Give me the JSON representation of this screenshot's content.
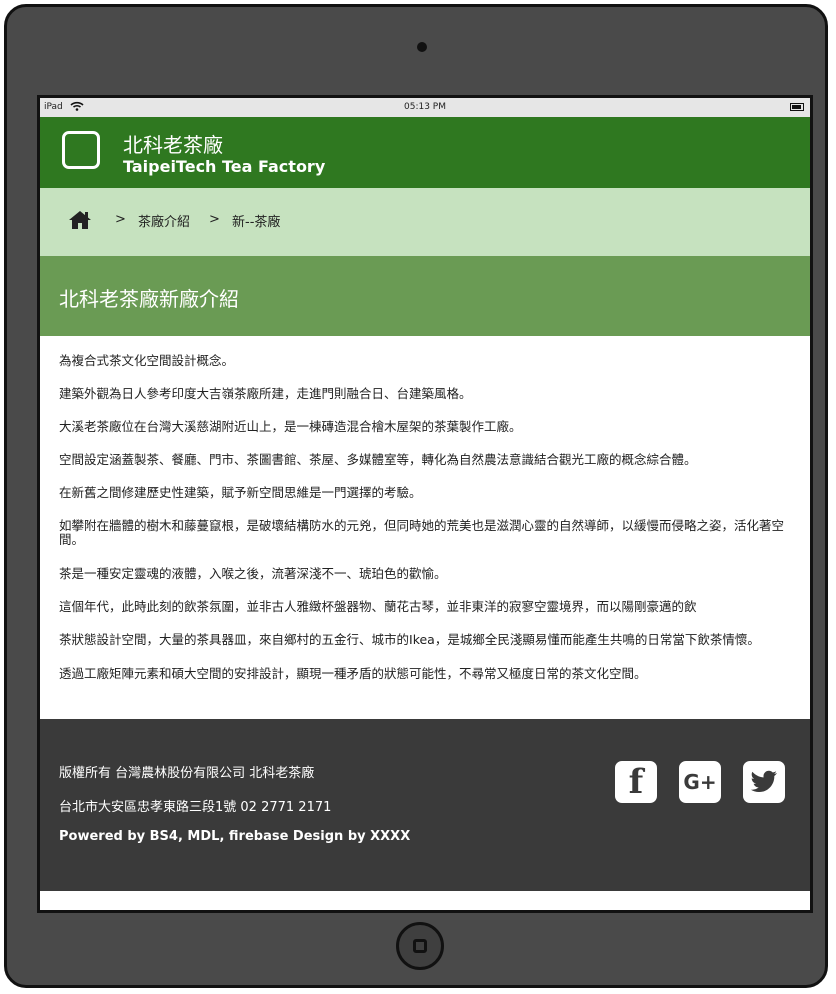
{
  "status_bar": {
    "carrier": "iPad",
    "time": "05:13 PM"
  },
  "header": {
    "brand_zh": "北科老茶廠",
    "brand_en": "TaipeiTech Tea Factory"
  },
  "breadcrumb": {
    "separator": ">",
    "items": [
      "茶廠介紹",
      "新--茶廠"
    ]
  },
  "section": {
    "title": "北科老茶廠新廠介紹"
  },
  "paragraphs": [
    "為複合式茶文化空間設計概念。",
    "建築外觀為日人參考印度大吉嶺茶廠所建，走進門則融合日、台建築風格。",
    "大溪老茶廠位在台灣大溪慈湖附近山上，是一棟磚造混合檜木屋架的茶葉製作工廠。",
    "空間設定涵蓋製茶、餐廳、門市、茶圖書館、茶屋、多媒體室等，轉化為自然農法意識結合觀光工廠的概念綜合體。",
    "在新舊之間修建歷史性建築，賦予新空間思維是一門選擇的考驗。",
    "如攀附在牆體的樹木和藤蔓竄根，是破壞結構防水的元兇，但同時她的荒美也是滋潤心靈的自然導師，以緩慢而侵略之姿，活化著空間。",
    "茶是一種安定靈魂的液體，入喉之後，流著深淺不一、琥珀色的歡愉。",
    "這個年代，此時此刻的飲茶氛圍，並非古人雅緻杯盤器物、蘭花古琴，並非東洋的寂寥空靈境界，而以陽剛豪邁的飲",
    "茶狀態設計空間，大量的茶具器皿，來自鄉村的五金行、城市的Ikea，是城鄉全民淺顯易懂而能產生共鳴的日常當下飲茶情懷。",
    "透過工廠矩陣元素和碩大空間的安排設計，顯現一種矛盾的狀態可能性，不尋常又極度日常的茶文化空間。"
  ],
  "footer": {
    "copyright": "版權所有 台灣農林股份有限公司 北科老茶廠",
    "address": "台北市大安區忠孝東路三段1號 02 2771 2171",
    "powered": "Powered by BS4, MDL, firebase Design by XXXX",
    "social": [
      {
        "icon": "facebook-icon",
        "glyph": "f"
      },
      {
        "icon": "google-plus-icon",
        "glyph": "G+"
      },
      {
        "icon": "twitter-icon",
        "glyph": ""
      }
    ]
  },
  "colors": {
    "header": "#2f7820",
    "breadcrumb": "#c6e2bf",
    "section_head": "#6a9b54",
    "footer": "#3a3a3a"
  }
}
